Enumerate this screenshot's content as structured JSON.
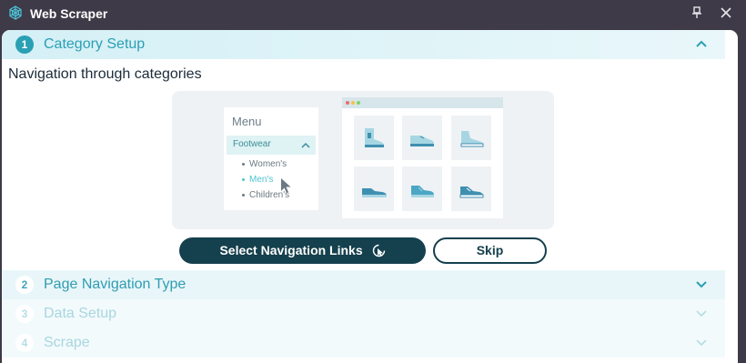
{
  "window": {
    "title": "Web Scraper",
    "icons": {
      "app": "spider-web-icon",
      "pin": "pin-icon",
      "close": "close-icon"
    }
  },
  "steps": [
    {
      "number": "1",
      "label": "Category Setup",
      "state": "expanded"
    },
    {
      "number": "2",
      "label": "Page Navigation Type",
      "state": "collapsed"
    },
    {
      "number": "3",
      "label": "Data Setup",
      "state": "disabled"
    },
    {
      "number": "4",
      "label": "Scrape",
      "state": "disabled"
    }
  ],
  "category_setup": {
    "subtitle": "Navigation through categories",
    "illustration": {
      "menu_title": "Menu",
      "selected_item": "Footwear",
      "sub_items": [
        "Women's",
        "Men's",
        "Children's"
      ],
      "active_sub_item": "Men's",
      "product_tiles": [
        "boot-icon",
        "shoe-icon",
        "sneaker-icon",
        "running-shoe-icon",
        "trainer-icon",
        "sport-shoe-icon"
      ]
    },
    "primary_button": "Select Navigation Links",
    "secondary_button": "Skip"
  },
  "colors": {
    "accent": "#2b9fb4",
    "button_dark": "#15404d",
    "titlebar": "#3e3a47"
  }
}
